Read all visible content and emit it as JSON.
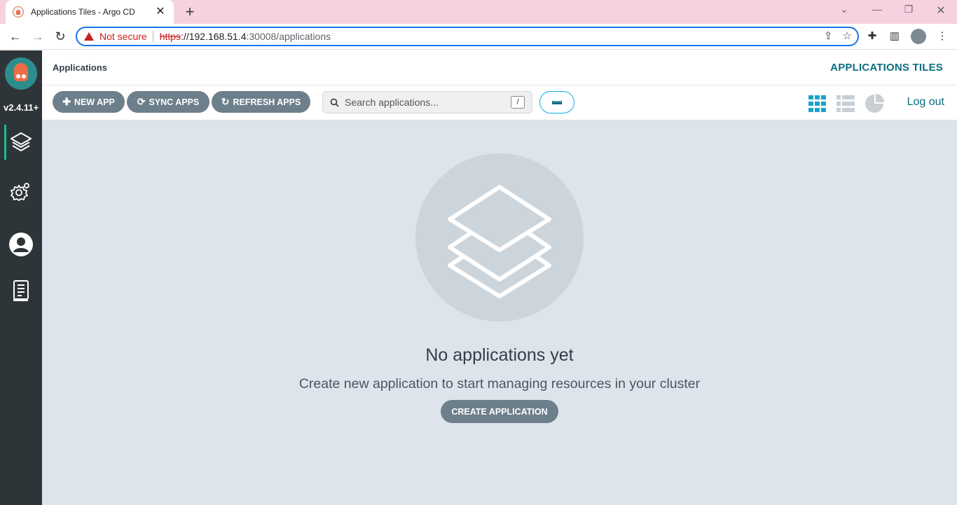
{
  "browser": {
    "tab_title": "Applications Tiles - Argo CD",
    "tab_close": "✕",
    "new_tab": "+",
    "not_secure": "Not secure",
    "url_scheme": "https",
    "url_host": "://192.168.51.4",
    "url_path": ":30008/applications"
  },
  "sidebar": {
    "version": "v2.4.11+",
    "items": [
      {
        "name": "applications",
        "icon": "layers-icon"
      },
      {
        "name": "settings",
        "icon": "gear-icon"
      },
      {
        "name": "user-info",
        "icon": "user-icon"
      },
      {
        "name": "documentation",
        "icon": "docs-icon"
      }
    ]
  },
  "header": {
    "breadcrumb": "Applications",
    "title": "APPLICATIONS TILES"
  },
  "toolbar": {
    "new_app": "NEW APP",
    "sync_apps": "SYNC APPS",
    "refresh_apps": "REFRESH APPS",
    "search_placeholder": "Search applications...",
    "search_shortcut": "/",
    "logout": "Log out"
  },
  "empty_state": {
    "title": "No applications yet",
    "subtitle": "Create new application to start managing resources in your cluster",
    "button": "CREATE APPLICATION"
  },
  "colors": {
    "sidebar": "#2e3538",
    "accent": "#0b6e80",
    "button": "#6d7f8b",
    "main_bg": "#dee4eb",
    "tab_strip": "#f6d2e1"
  }
}
